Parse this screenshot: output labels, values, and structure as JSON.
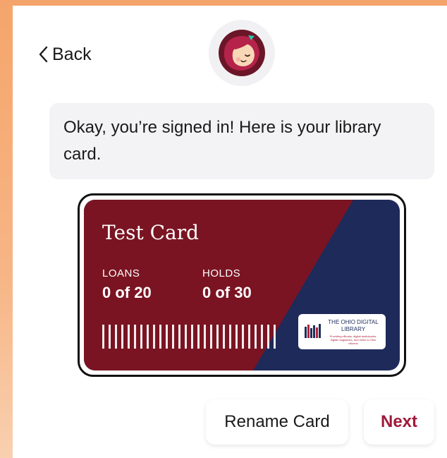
{
  "header": {
    "back_label": "Back",
    "back_icon": "chevron-left-icon",
    "avatar_icon": "libby-avatar-icon"
  },
  "message": {
    "text": "Okay, you’re signed in! Here is your library card."
  },
  "card": {
    "name": "Test Card",
    "loans_label": "LOANS",
    "loans_value": "0 of 20",
    "holds_label": "HOLDS",
    "holds_value": "0 of 30",
    "library_name": "THE OHIO DIGITAL LIBRARY",
    "library_tagline": "Providing eBooks, digital audiobooks, digital magazines, and video to Ohio citizens",
    "colors": {
      "primary": "#7a1422",
      "secondary": "#1e2a5a"
    }
  },
  "actions": {
    "rename_label": "Rename Card",
    "next_label": "Next",
    "next_color": "#a01a3a"
  }
}
